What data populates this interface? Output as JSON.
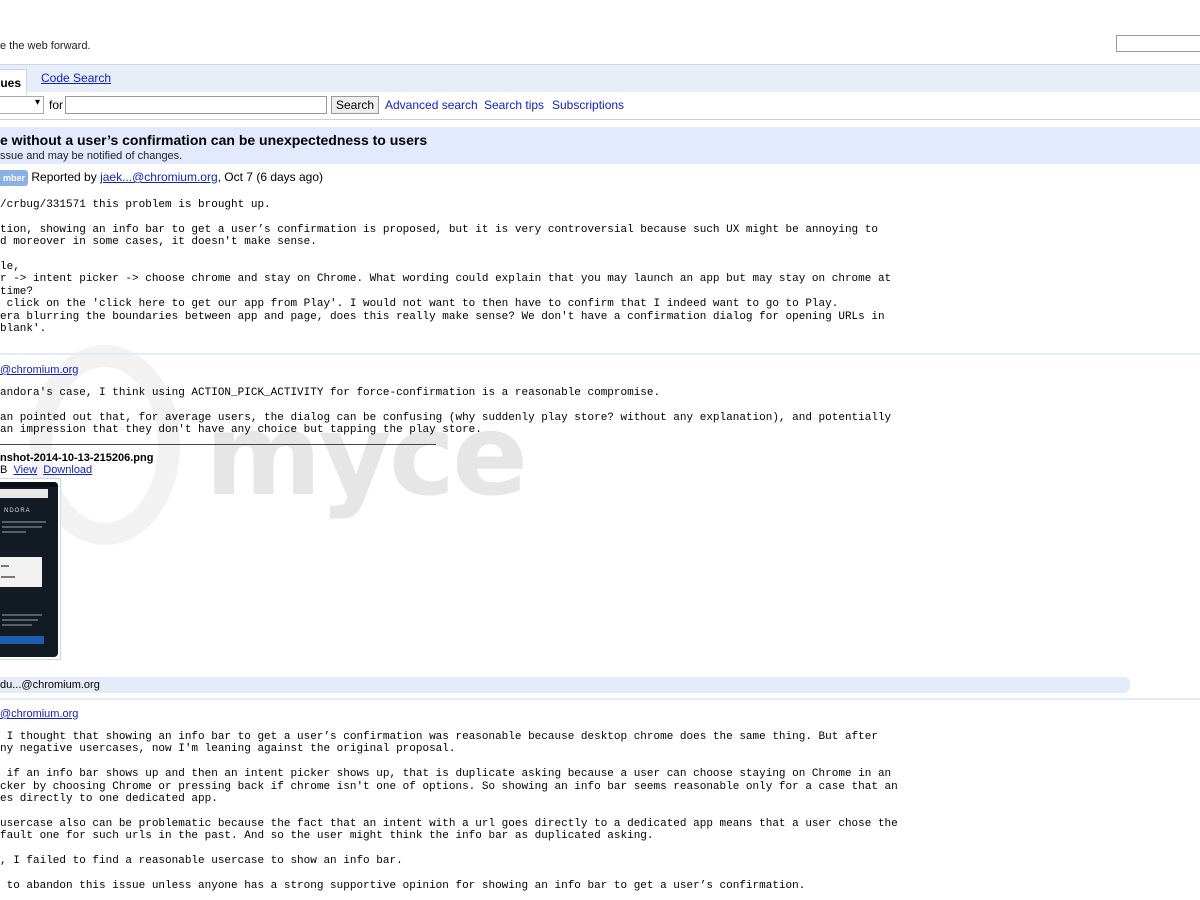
{
  "header": {
    "tagline": "e the web forward."
  },
  "tabs": {
    "issues_label": "ues",
    "code_search_label": "Code Search"
  },
  "searchbar": {
    "scope_value": "▾",
    "for_label": "for",
    "search_button": "Search",
    "advanced_search": "Advanced search",
    "search_tips": "Search tips",
    "subscriptions": "Subscriptions"
  },
  "issue": {
    "title": "e without a user’s confirmation can be unexpectedness to users",
    "subtitle": "ssue and may be notified of changes."
  },
  "report": {
    "badge": "mber",
    "reported_by": "Reported by",
    "reporter": "jaek...@chromium.org",
    "date": ", Oct 7 (6 days ago)"
  },
  "description": {
    "body": "/crbug/331571 this problem is brought up.\n\ntion, showing an info bar to get a user’s confirmation is proposed, but it is very controversial because such UX might be annoying to\nd moreover in some cases, it doesn't make sense.\n\nle,\nr -> intent picker -> choose chrome and stay on Chrome. What wording could explain that you may launch an app but may stay on chrome at\ntime?\n click on the 'click here to get our app from Play'. I would not want to then have to confirm that I indeed want to go to Play.\nera blurring the boundaries between app and page, does this really make sense? We don't have a confirmation dialog for opening URLs in\nblank'."
  },
  "comment1": {
    "author": "@chromium.org",
    "body": "andora's case, I think using ACTION_PICK_ACTIVITY for force-confirmation is a reasonable compromise.\n\nan pointed out that, for average users, the dialog can be confusing (why suddenly play store? without any explanation), and potentially\nan impression that they don't have any choice but tapping the play store.",
    "attachment": {
      "name": "nshot-2014-10-13-215206.png",
      "size": "B",
      "view": "View",
      "download": "Download"
    },
    "cc": "du...@chromium.org"
  },
  "thumbnail": {
    "brand": "NDORA"
  },
  "watermark": {
    "text": "myce"
  },
  "comment2": {
    "author": "@chromium.org",
    "body": " I thought that showing an info bar to get a user’s confirmation was reasonable because desktop chrome does the same thing. But after\nny negative usercases, now I'm leaning against the original proposal.\n\n if an info bar shows up and then an intent picker shows up, that is duplicate asking because a user can choose staying on Chrome in an\ncker by choosing Chrome or pressing back if chrome isn't one of options. So showing an info bar seems reasonable only for a case that an\nes directly to one dedicated app.\n\nusercase also can be problematic because the fact that an intent with a url goes directly to a dedicated app means that a user chose the\nfault one for such urls in the past. And so the user might think the info bar as duplicated asking.\n\n, I failed to find a reasonable usercase to show an info bar.\n\n to abandon this issue unless anyone has a strong supportive opinion for showing an info bar to get a user’s confirmation."
  }
}
